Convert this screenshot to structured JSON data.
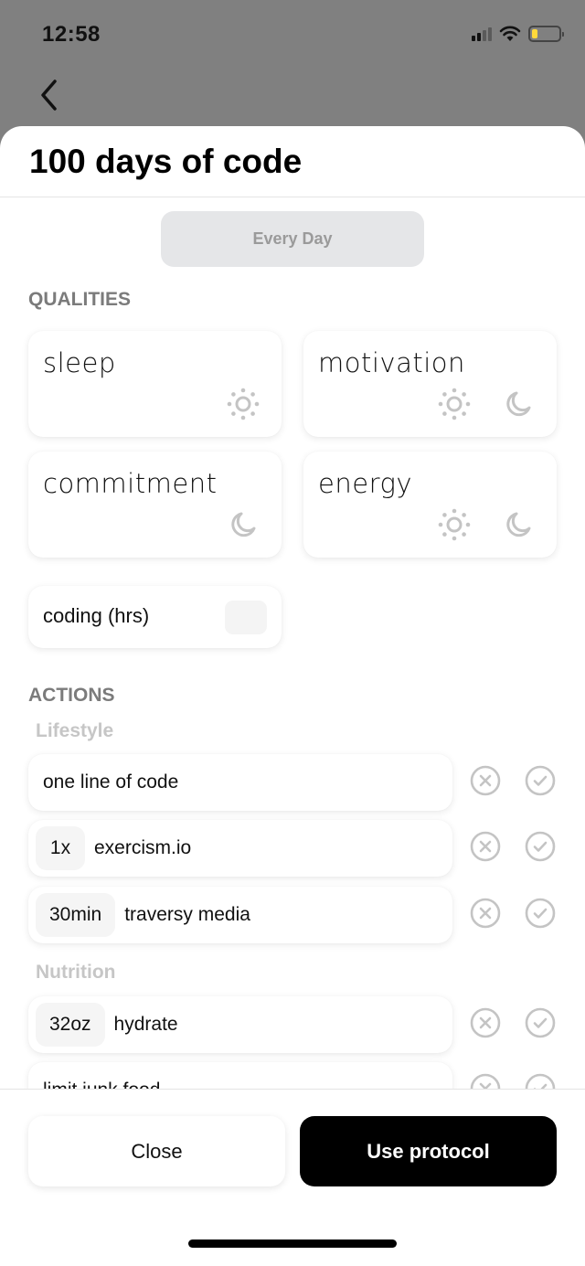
{
  "status_bar": {
    "time": "12:58",
    "signal_bars_active": 2,
    "signal_bars_total": 4,
    "battery_color": "#ffd93b",
    "icons": [
      "signal-icon",
      "wifi-icon",
      "battery-icon"
    ]
  },
  "nav": {
    "back_icon": "chevron-left-icon"
  },
  "sheet": {
    "title": "100 days of code",
    "schedule_label": "Every Day"
  },
  "qualities": {
    "title": "QUALITIES",
    "items": [
      {
        "label": "sleep",
        "icons": [
          "sun-icon"
        ]
      },
      {
        "label": "motivation",
        "icons": [
          "sun-icon",
          "moon-icon"
        ]
      },
      {
        "label": "commitment",
        "icons": [
          "moon-icon"
        ]
      },
      {
        "label": "energy",
        "icons": [
          "sun-icon",
          "moon-icon"
        ]
      }
    ],
    "metrics": [
      {
        "label": "coding (hrs)",
        "value": ""
      }
    ]
  },
  "actions": {
    "title": "ACTIONS",
    "groups": [
      {
        "title": "Lifestyle",
        "items": [
          {
            "qty": "",
            "name": "one line of code"
          },
          {
            "qty": "1x",
            "name": "exercism.io"
          },
          {
            "qty": "30min",
            "name": "traversy media"
          }
        ]
      },
      {
        "title": "Nutrition",
        "items": [
          {
            "qty": "32oz",
            "name": "hydrate"
          },
          {
            "qty": "",
            "name": "limit junk food"
          }
        ]
      }
    ]
  },
  "footer": {
    "close_label": "Close",
    "use_label": "Use protocol"
  }
}
